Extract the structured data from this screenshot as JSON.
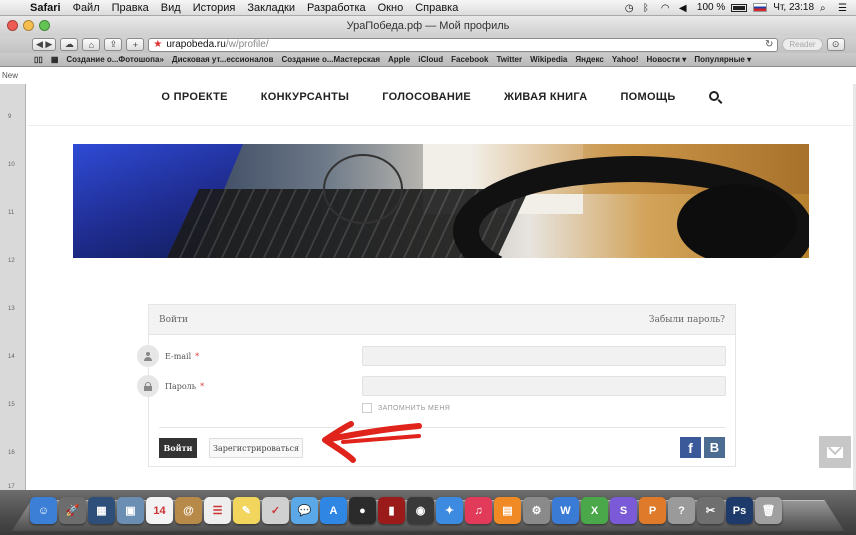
{
  "menubar": {
    "apple": "",
    "items": [
      "Safari",
      "Файл",
      "Правка",
      "Вид",
      "История",
      "Закладки",
      "Разработка",
      "Окно",
      "Справка"
    ],
    "battery": "100 %",
    "clock": "Чт, 23:18"
  },
  "browser": {
    "title": "УраПобеда.рф — Мой профиль",
    "url_host": "urapobeda.ru",
    "url_path": "/w/profile/",
    "reader_label": "Reader",
    "new_tab_label": "New",
    "bookmarks": [
      "Создание о...Фотошопа»",
      "Дисковая ут...ессионалов",
      "Создание о...Мастерская",
      "Apple",
      "iCloud",
      "Facebook",
      "Twitter",
      "Wikipedia",
      "Яндекс",
      "Yahoo!",
      "Новости ▾",
      "Популярные ▾"
    ]
  },
  "ruler": [
    "9",
    "10",
    "11",
    "12",
    "13",
    "14",
    "15",
    "16",
    "17"
  ],
  "nav": {
    "items": [
      "О ПРОЕКТЕ",
      "КОНКУРСАНТЫ",
      "ГОЛОСОВАНИЕ",
      "ЖИВАЯ КНИГА",
      "ПОМОЩЬ"
    ]
  },
  "login": {
    "header_title": "Войти",
    "forgot_link": "Забыли пароль?",
    "email_label": "E-mail",
    "password_label": "Пароль",
    "required_mark": "*",
    "remember_label": "ЗАПОМНИТЬ МЕНЯ",
    "login_button": "Войти",
    "register_button": "Зарегистрироваться",
    "facebook_glyph": "f",
    "vk_glyph": "B"
  },
  "colors": {
    "arrow": "#e0241b",
    "facebook": "#3b5998",
    "vk": "#4c6c92",
    "login_button": "#333333"
  },
  "dock": {
    "icons": [
      {
        "name": "finder-icon",
        "color": "#3b7fd6",
        "glyph": "☺"
      },
      {
        "name": "launchpad-icon",
        "color": "#6d6d6d",
        "glyph": "🚀"
      },
      {
        "name": "mission-control-icon",
        "color": "#2d4f7a",
        "glyph": "▦"
      },
      {
        "name": "preview-icon",
        "color": "#6b8fb3",
        "glyph": "▣"
      },
      {
        "name": "calendar-icon",
        "color": "#f3f3f3",
        "glyph": "14"
      },
      {
        "name": "contacts-icon",
        "color": "#b88a4a",
        "glyph": "@"
      },
      {
        "name": "reminders-icon",
        "color": "#eeeeee",
        "glyph": "☰"
      },
      {
        "name": "notes-icon",
        "color": "#f2d55c",
        "glyph": "✎"
      },
      {
        "name": "textedit-icon",
        "color": "#d0d0d0",
        "glyph": "✓"
      },
      {
        "name": "messages-icon",
        "color": "#5aa8e8",
        "glyph": "💬"
      },
      {
        "name": "app-store-icon",
        "color": "#2f86e3",
        "glyph": "A"
      },
      {
        "name": "facetime-icon",
        "color": "#2b2b2b",
        "glyph": "●"
      },
      {
        "name": "photo-booth-icon",
        "color": "#9b1b1b",
        "glyph": "▮"
      },
      {
        "name": "dvd-icon",
        "color": "#3a3a3a",
        "glyph": "◉"
      },
      {
        "name": "safari-icon",
        "color": "#3d8be0",
        "glyph": "✦"
      },
      {
        "name": "itunes-icon",
        "color": "#e23b5a",
        "glyph": "♫"
      },
      {
        "name": "ibooks-icon",
        "color": "#f08a24",
        "glyph": "▤"
      },
      {
        "name": "system-preferences-icon",
        "color": "#8a8a8a",
        "glyph": "⚙"
      },
      {
        "name": "word-icon",
        "color": "#3a7bd5",
        "glyph": "W"
      },
      {
        "name": "excel-icon",
        "color": "#4aa84a",
        "glyph": "X"
      },
      {
        "name": "skype-icon",
        "color": "#7a5ad6",
        "glyph": "S"
      },
      {
        "name": "powerpoint-icon",
        "color": "#e07a2b",
        "glyph": "P"
      },
      {
        "name": "help-icon",
        "color": "#9a9a9a",
        "glyph": "?"
      },
      {
        "name": "utility-icon",
        "color": "#6f6f6f",
        "glyph": "✂"
      },
      {
        "name": "photoshop-icon",
        "color": "#1d3a6b",
        "glyph": "Ps"
      },
      {
        "name": "trash-icon",
        "color": "#a0a0a0",
        "glyph": "🗑"
      }
    ]
  }
}
